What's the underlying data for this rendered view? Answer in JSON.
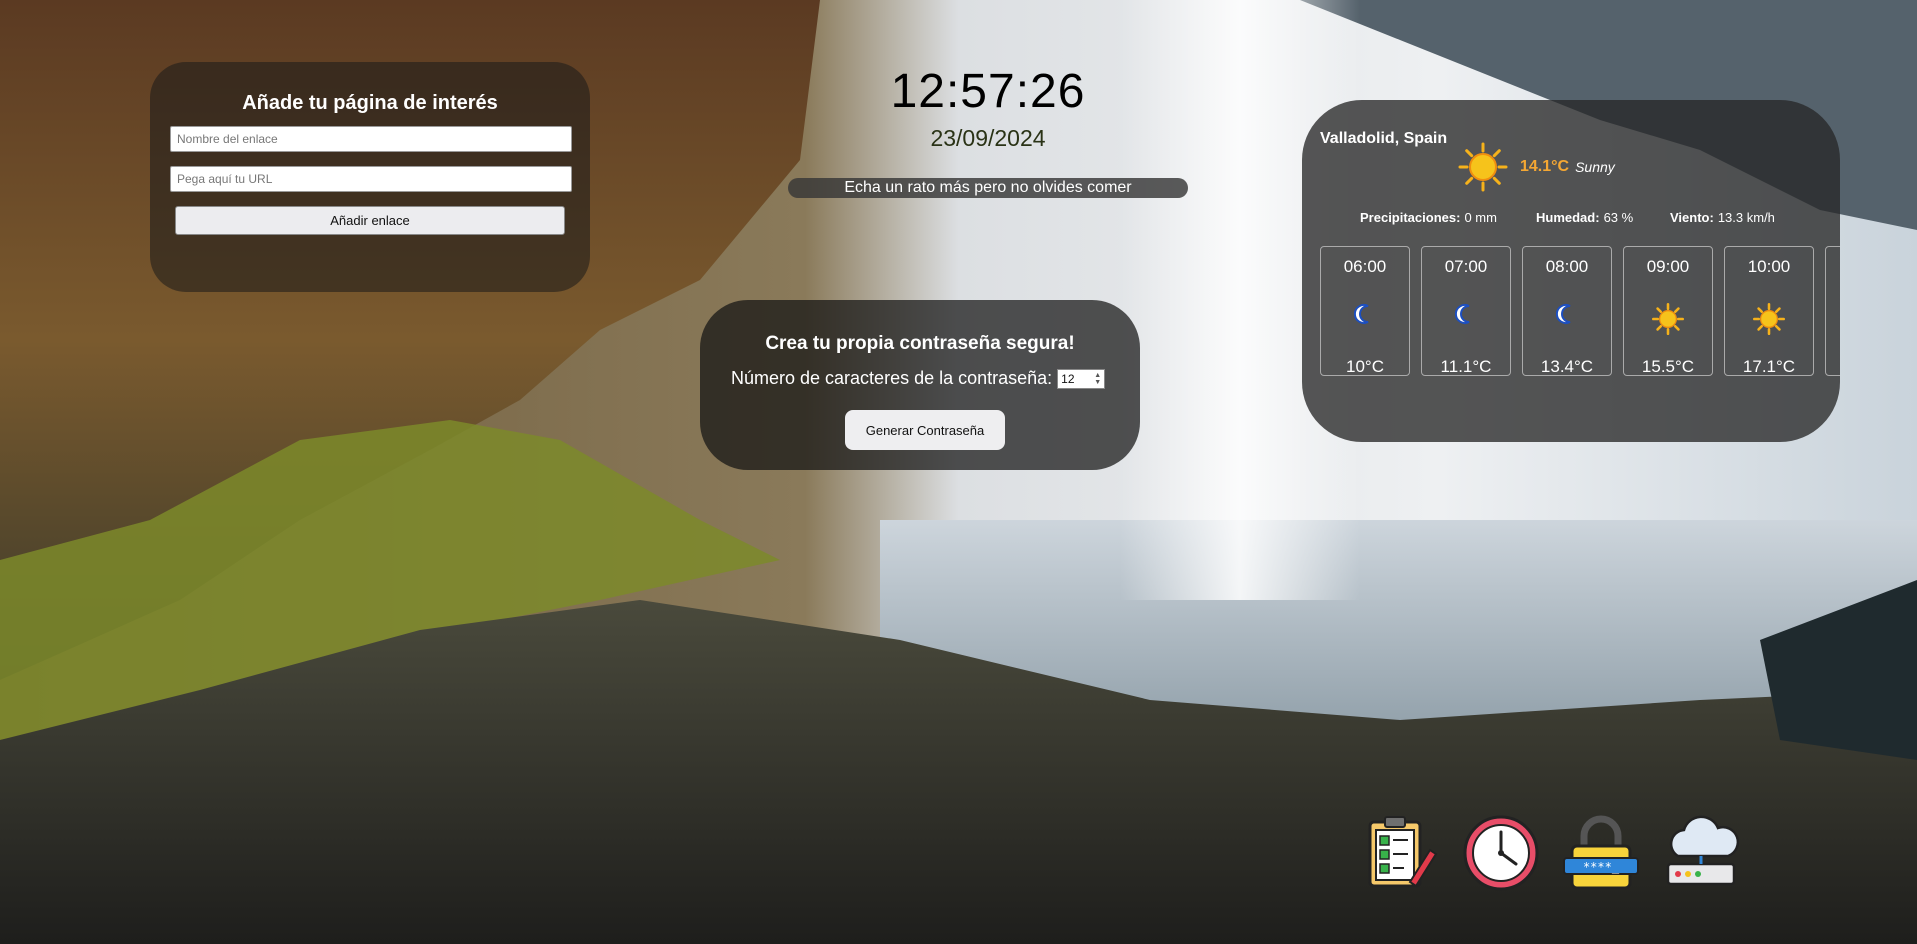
{
  "link_form": {
    "title": "Añade tu página de interés",
    "name_placeholder": "Nombre del enlace",
    "url_placeholder": "Pega aquí tu URL",
    "add_button": "Añadir enlace"
  },
  "clock": {
    "time": "12:57:26",
    "date": "23/09/2024",
    "message": "Echa un rato más pero no olvides comer"
  },
  "password_generator": {
    "title": "Crea tu propia contraseña segura!",
    "length_label": "Número de caracteres de la contraseña:",
    "length_value": "12",
    "generate_button": "Generar Contraseña"
  },
  "weather": {
    "location": "Valladolid, Spain",
    "current_temp": "14.1°C",
    "condition": "Sunny",
    "current_icon": "sun-icon",
    "accent_color": "#f4a733",
    "stats": [
      {
        "label": "Precipitaciones:",
        "value": "0 mm"
      },
      {
        "label": "Humedad:",
        "value": "63 %"
      },
      {
        "label": "Viento:",
        "value": "13.3 km/h"
      }
    ],
    "hourly": [
      {
        "time": "06:00",
        "icon": "moon-icon",
        "temp": "10°C"
      },
      {
        "time": "07:00",
        "icon": "moon-icon",
        "temp": "11.1°C"
      },
      {
        "time": "08:00",
        "icon": "moon-icon",
        "temp": "13.4°C"
      },
      {
        "time": "09:00",
        "icon": "sun-icon",
        "temp": "15.5°C"
      },
      {
        "time": "10:00",
        "icon": "sun-icon",
        "temp": "17.1°C"
      }
    ]
  },
  "dock": [
    {
      "icon": "checklist-icon"
    },
    {
      "icon": "clock-icon"
    },
    {
      "icon": "password-lock-icon"
    },
    {
      "icon": "cloud-weather-icon"
    }
  ]
}
